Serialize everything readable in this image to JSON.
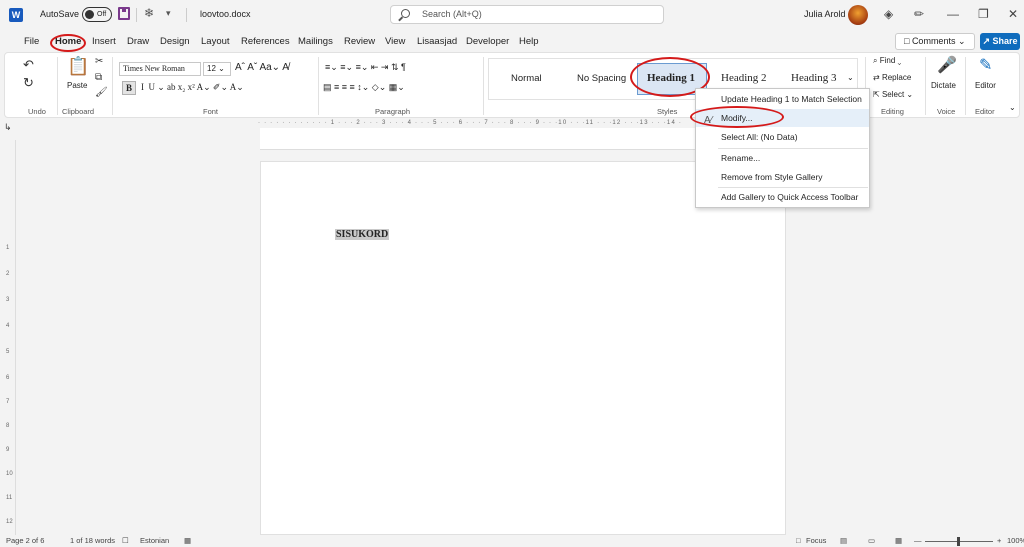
{
  "titlebar": {
    "autosave_label": "AutoSave",
    "autosave_state": "Off",
    "filename": "loovtoo.docx",
    "search_placeholder": "Search (Alt+Q)",
    "username": "Julia Arold"
  },
  "menu": {
    "tabs": [
      "File",
      "Home",
      "Insert",
      "Draw",
      "Design",
      "Layout",
      "References",
      "Mailings",
      "Review",
      "View",
      "Lisaasjad",
      "Developer",
      "Help"
    ],
    "active_tab": "Home",
    "comments_label": "Comments",
    "share_label": "Share"
  },
  "ribbon": {
    "groups": [
      "Undo",
      "Clipboard",
      "Font",
      "Paragraph",
      "Styles",
      "Editing",
      "Voice",
      "Editor"
    ],
    "paste_label": "Paste",
    "font_name": "Times New Roman",
    "font_size": "12",
    "styles": [
      "Normal",
      "No Spacing",
      "Heading 1",
      "Heading 2",
      "Heading 3"
    ],
    "selected_style": "Heading 1",
    "editing": {
      "find": "Find",
      "replace": "Replace",
      "select": "Select"
    },
    "dictate_label": "Dictate",
    "editor_label": "Editor"
  },
  "ruler": {
    "text": "· · · · · · · · · · · · 1 · · · 2 · · · 3 · · · 4 · · · 5 · · · 6 · · · 7 · · · 8 · · · 9 · · ·10 · · ·11 · · ·12 · · ·13 · · ·14 ·",
    "vertical_numbers": [
      "1",
      "2",
      "3",
      "4",
      "5",
      "6",
      "7",
      "8",
      "9",
      "10",
      "11",
      "12"
    ]
  },
  "document": {
    "heading_text": "SISUKORD"
  },
  "context_menu": {
    "items": [
      "Update Heading 1 to Match Selection",
      "Modify...",
      "Select All: (No Data)",
      "Rename...",
      "Remove from Style Gallery",
      "Add Gallery to Quick Access Toolbar"
    ],
    "hovered_item": "Modify..."
  },
  "statusbar": {
    "page": "Page 2 of 6",
    "words": "1 of 18 words",
    "language": "Estonian",
    "focus_label": "Focus",
    "zoom": "100%"
  },
  "colors": {
    "accent": "#0f6cbd",
    "word_blue": "#185abd",
    "annotation_red": "#d41a1a"
  }
}
